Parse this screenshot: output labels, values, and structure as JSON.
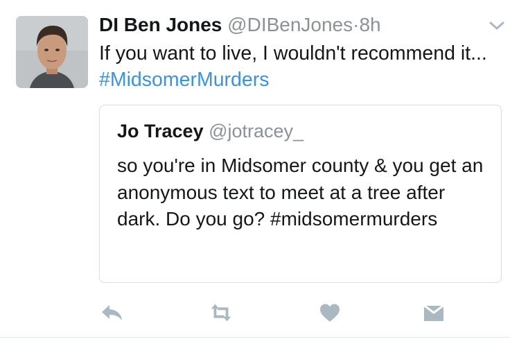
{
  "tweet": {
    "author": {
      "display_name": "DI Ben Jones",
      "handle": "@DIBenJones",
      "separator": "·",
      "time": "8h"
    },
    "text": "If you want to live, I wouldn't recommend it...",
    "hashtag": "#MidsomerMurders",
    "menu_icon": "chevron-down-icon"
  },
  "quoted_tweet": {
    "display_name": "Jo Tracey",
    "handle": "@jotracey_",
    "text": "so you're in Midsomer county & you get an anonymous text to meet at a tree after dark. Do you go?",
    "hashtag": "#midsomermurders"
  },
  "actions": [
    {
      "name": "reply",
      "icon": "reply-icon"
    },
    {
      "name": "retweet",
      "icon": "retweet-icon"
    },
    {
      "name": "like",
      "icon": "heart-icon"
    },
    {
      "name": "direct-message",
      "icon": "envelope-icon"
    }
  ],
  "colors": {
    "text": "#14171a",
    "secondary_text": "#8a9299",
    "link": "#3b94d9",
    "icon": "#aab8c2",
    "border": "#d7dde2"
  }
}
